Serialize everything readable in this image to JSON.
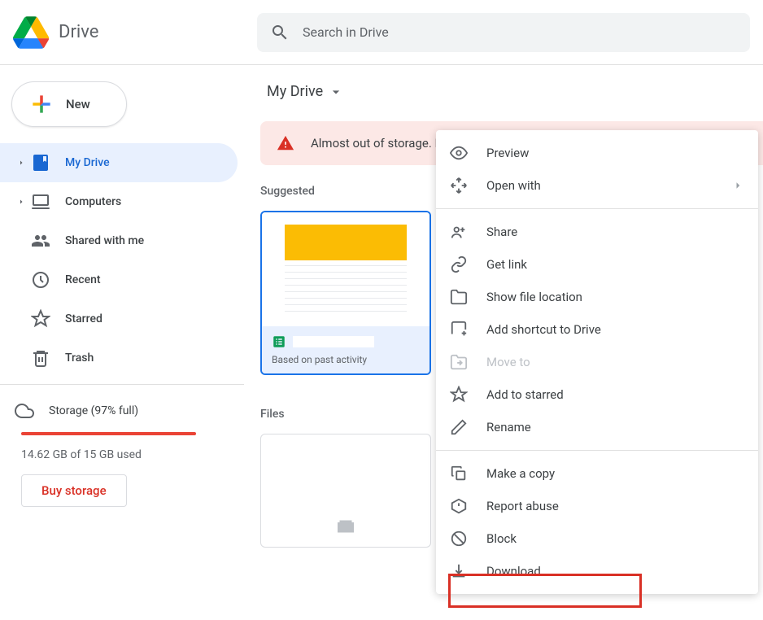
{
  "header": {
    "title": "Drive",
    "search_placeholder": "Search in Drive"
  },
  "sidebar": {
    "new_label": "New",
    "items": [
      {
        "label": "My Drive",
        "active": true,
        "has_chevron": true
      },
      {
        "label": "Computers",
        "active": false,
        "has_chevron": true
      },
      {
        "label": "Shared with me",
        "active": false,
        "has_chevron": false
      },
      {
        "label": "Recent",
        "active": false,
        "has_chevron": false
      },
      {
        "label": "Starred",
        "active": false,
        "has_chevron": false
      },
      {
        "label": "Trash",
        "active": false,
        "has_chevron": false
      }
    ],
    "storage": {
      "label": "Storage (97% full)",
      "used": "14.62 GB of 15 GB used",
      "buy_label": "Buy storage"
    }
  },
  "main": {
    "breadcrumb": "My Drive",
    "warning": "Almost out of storage. If you run out, you can't create or edit files, se",
    "suggested_label": "Suggested",
    "suggested_card": {
      "subtitle": "Based on past activity"
    },
    "files_label": "Files"
  },
  "context_menu": {
    "items": [
      {
        "label": "Preview",
        "disabled": false
      },
      {
        "label": "Open with",
        "disabled": false,
        "has_chevron": true
      },
      {
        "label": "Share",
        "disabled": false
      },
      {
        "label": "Get link",
        "disabled": false
      },
      {
        "label": "Show file location",
        "disabled": false
      },
      {
        "label": "Add shortcut to Drive",
        "disabled": false
      },
      {
        "label": "Move to",
        "disabled": true
      },
      {
        "label": "Add to starred",
        "disabled": false
      },
      {
        "label": "Rename",
        "disabled": false
      },
      {
        "label": "Make a copy",
        "disabled": false
      },
      {
        "label": "Report abuse",
        "disabled": false
      },
      {
        "label": "Block",
        "disabled": false
      },
      {
        "label": "Download",
        "disabled": false
      }
    ]
  }
}
